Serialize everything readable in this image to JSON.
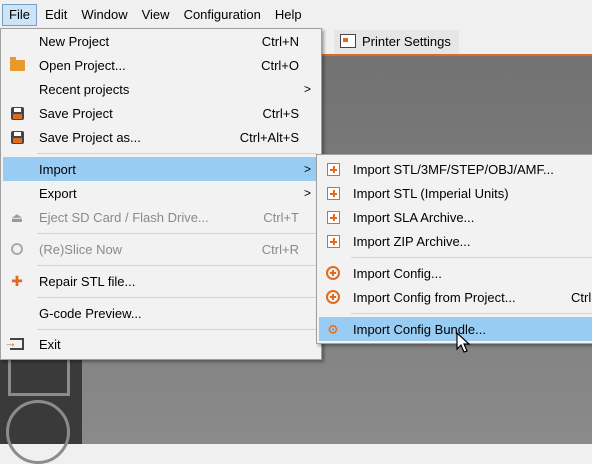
{
  "menubar": {
    "items": [
      "File",
      "Edit",
      "Window",
      "View",
      "Configuration",
      "Help"
    ]
  },
  "tab": {
    "label": "Printer Settings"
  },
  "file_menu": {
    "items": [
      {
        "label": "New Project",
        "shortcut": "Ctrl+N",
        "icon": "none"
      },
      {
        "label": "Open Project...",
        "shortcut": "Ctrl+O",
        "icon": "folder-icon"
      },
      {
        "label": "Recent projects",
        "shortcut": "",
        "icon": "none",
        "submenu": true
      },
      {
        "label": "Save Project",
        "shortcut": "Ctrl+S",
        "icon": "save-icon"
      },
      {
        "label": "Save Project as...",
        "shortcut": "Ctrl+Alt+S",
        "icon": "save-as-icon"
      },
      {
        "label": "Import",
        "shortcut": "",
        "icon": "none",
        "submenu": true,
        "highlighted": true
      },
      {
        "label": "Export",
        "shortcut": "",
        "icon": "none",
        "submenu": true
      },
      {
        "label": "Eject SD Card / Flash Drive...",
        "shortcut": "Ctrl+T",
        "icon": "eject-icon",
        "disabled": true
      },
      {
        "label": "(Re)Slice Now",
        "shortcut": "Ctrl+R",
        "icon": "reslice-icon",
        "disabled": true
      },
      {
        "label": "Repair STL file...",
        "shortcut": "",
        "icon": "repair-icon"
      },
      {
        "label": "G-code Preview...",
        "shortcut": "",
        "icon": "none"
      },
      {
        "label": "Exit",
        "shortcut": "",
        "icon": "exit-icon"
      }
    ]
  },
  "import_menu": {
    "items": [
      {
        "label": "Import STL/3MF/STEP/OBJ/AMF...",
        "shortcut": "",
        "icon": "add-square-icon"
      },
      {
        "label": "Import STL (Imperial Units)",
        "shortcut": "",
        "icon": "add-square-icon"
      },
      {
        "label": "Import SLA Archive...",
        "shortcut": "",
        "icon": "add-square-icon"
      },
      {
        "label": "Import ZIP Archive...",
        "shortcut": "",
        "icon": "add-square-icon"
      },
      {
        "label": "Import Config...",
        "shortcut": "",
        "icon": "add-circle-icon"
      },
      {
        "label": "Import Config from Project...",
        "shortcut": "Ctrl",
        "icon": "add-circle-icon"
      },
      {
        "label": "Import Config Bundle...",
        "shortcut": "",
        "icon": "import-bundle-icon",
        "highlighted": true
      }
    ]
  },
  "colors": {
    "accent": "#e06b1f",
    "highlight": "#99ccf3",
    "menu_bg": "#f2f2f2"
  }
}
